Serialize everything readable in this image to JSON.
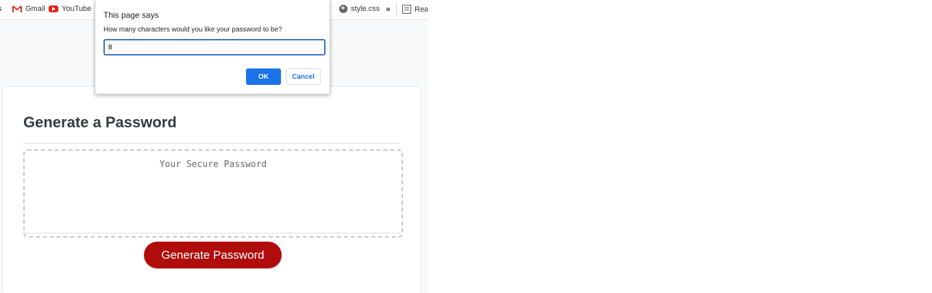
{
  "bookmarks_bar": {
    "partial_left": "s",
    "items": [
      {
        "label": "Gmail",
        "icon": "gmail-icon"
      },
      {
        "label": "YouTube",
        "icon": "youtube-icon"
      },
      {
        "label": ".",
        "icon": ""
      },
      {
        "label": "style.css",
        "icon": "globe-icon"
      },
      {
        "label": "»",
        "icon": "chevron-double-right-icon"
      },
      {
        "label": "Read",
        "icon": "reading-list-icon"
      }
    ]
  },
  "dialog": {
    "title": "This page says",
    "message": "How many characters would you like your password to be?",
    "input_value": "8",
    "ok_label": "OK",
    "cancel_label": "Cancel",
    "accent_color": "#1a73e8"
  },
  "card": {
    "title": "Generate a Password",
    "password_placeholder": "Your Secure Password",
    "generate_button_label": "Generate Password",
    "button_color": "#b00c0c"
  }
}
